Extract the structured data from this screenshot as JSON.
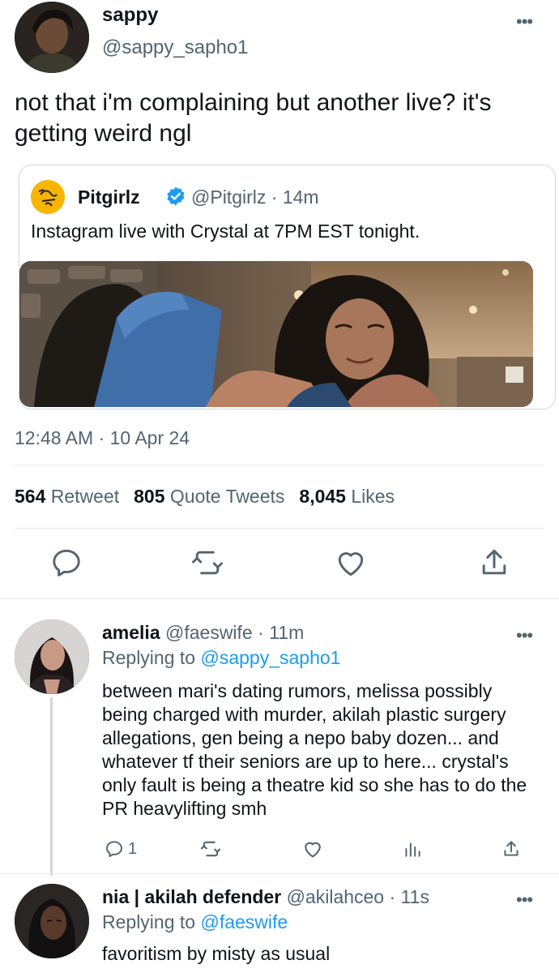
{
  "main_tweet": {
    "name": "sappy",
    "handle": "@sappy_sapho1",
    "text": "not that i'm complaining but another live? it's getting weird ngl",
    "timestamp": "12:48 AM · 10 Apr 24",
    "stats": {
      "retweets_count": "564",
      "retweets_label": "Retweet",
      "quotes_count": "805",
      "quotes_label": "Quote Tweets",
      "likes_count": "8,045",
      "likes_label": "Likes"
    },
    "actions": [
      "reply-icon",
      "retweet-icon",
      "like-icon",
      "share-icon"
    ]
  },
  "quoted_tweet": {
    "name": "Pitgirlz",
    "handle": "@Pitgirlz",
    "time": "14m",
    "text": "Instagram live with Crystal at 7PM EST tonight.",
    "verified": true
  },
  "replies": [
    {
      "name": "amelia",
      "handle": "@faeswife",
      "time": "11m",
      "replying_label": "Replying to",
      "replying_to": "@sappy_sapho1",
      "text": "between mari's dating rumors, melissa possibly being charged with murder, akilah plastic surgery allegations, gen being a nepo baby dozen... and whatever tf their seniors are up to here... crystal's only fault is being a theatre kid so she has to do the PR heavylifting smh",
      "reply_count": "1"
    },
    {
      "name": "nia | akilah defender",
      "handle": "@akilahceo",
      "time": "11s",
      "replying_label": "Replying to",
      "replying_to": "@faeswife",
      "text": "favoritism by misty as usual"
    }
  ],
  "colors": {
    "accent": "#1d9bf0",
    "muted": "#536471",
    "text": "#0f1419",
    "border": "#cfd9de"
  }
}
